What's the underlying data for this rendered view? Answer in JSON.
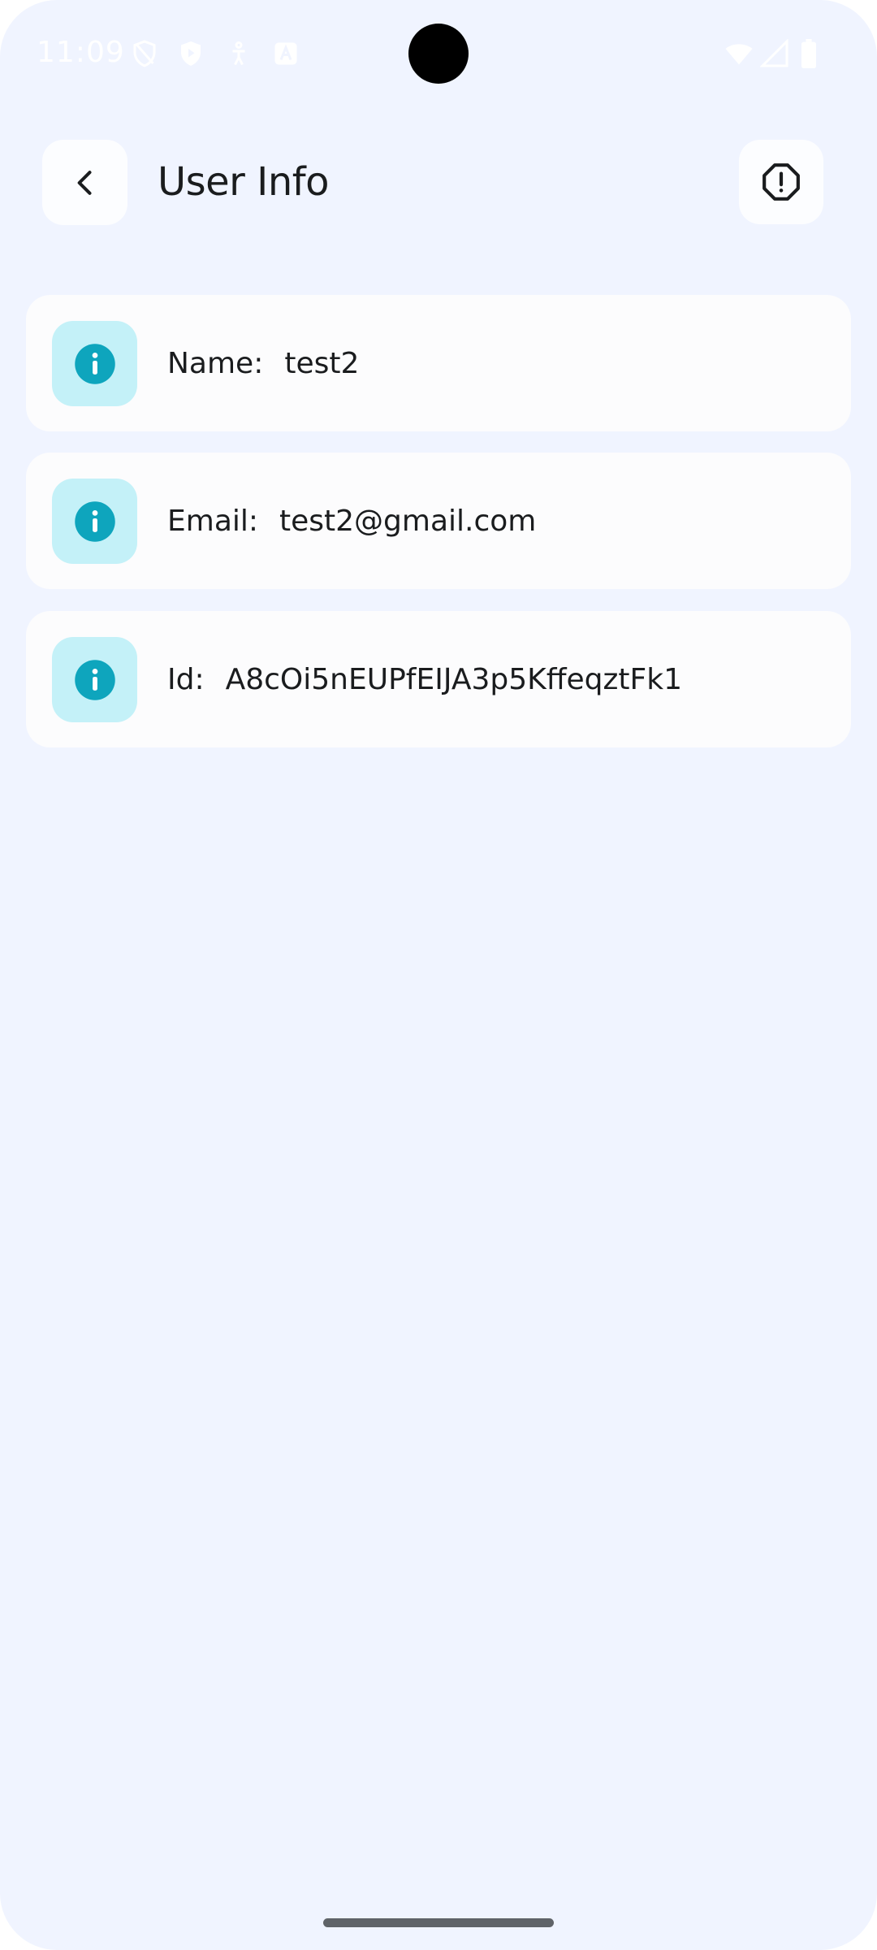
{
  "status_bar": {
    "time": "11:09",
    "left_icons": [
      "shield-off-icon",
      "shield-play-icon",
      "accessibility-icon",
      "store-icon"
    ],
    "right_icons": [
      "wifi-icon",
      "cell-signal-icon",
      "battery-icon"
    ]
  },
  "header": {
    "title": "User Info",
    "back_icon": "chevron-left-icon",
    "action_icon": "report-octagon-icon"
  },
  "info_items": [
    {
      "label": "Name:",
      "value": "test2",
      "icon": "info-icon"
    },
    {
      "label": "Email:",
      "value": "test2@gmail.com",
      "icon": "info-icon"
    },
    {
      "label": "Id:",
      "value": "A8cOi5nEUPfEIJA3p5KffeqztFk1",
      "icon": "info-icon"
    }
  ],
  "colors": {
    "background": "#f0f4ff",
    "card": "#fcfcfd",
    "icon_box": "#c4f1f8",
    "icon_accent": "#0ea5bd",
    "text": "#1a1c1e"
  }
}
